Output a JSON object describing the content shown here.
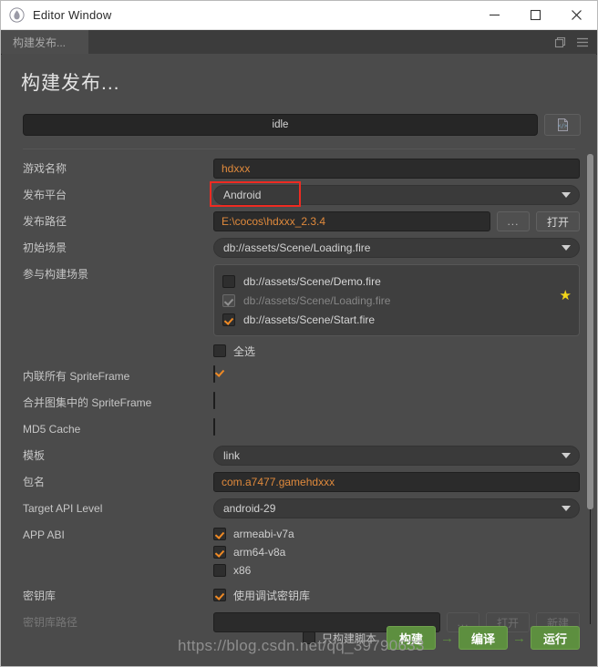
{
  "window": {
    "title": "Editor Window",
    "icon": "flame-icon",
    "minimize": "—",
    "maximize": "□",
    "close": "✕"
  },
  "tabbar": {
    "tab_label": "构建发布...",
    "popout_icon": "popout-window-icon",
    "menu_icon": "hamburger-menu-icon"
  },
  "page": {
    "title": "构建发布..."
  },
  "progress": {
    "status": "idle",
    "log_button_icon": "document-log-icon"
  },
  "fields": {
    "game_name": {
      "label": "游戏名称",
      "value": "hdxxx"
    },
    "platform": {
      "label": "发布平台",
      "value": "Android",
      "highlighted": true
    },
    "build_path": {
      "label": "发布路径",
      "value": "E:\\cocos\\hdxxx_2.3.4",
      "browse_label": "...",
      "open_label": "打开"
    },
    "start_scene": {
      "label": "初始场景",
      "value": "db://assets/Scene/Loading.fire"
    },
    "build_scenes": {
      "label": "参与构建场景",
      "items": [
        {
          "name": "db://assets/Scene/Demo.fire",
          "checked": false,
          "disabled": false,
          "starred": false
        },
        {
          "name": "db://assets/Scene/Loading.fire",
          "checked": true,
          "disabled": true,
          "starred": true
        },
        {
          "name": "db://assets/Scene/Start.fire",
          "checked": true,
          "disabled": false,
          "starred": false
        }
      ],
      "select_all_label": "全选",
      "select_all_checked": false
    },
    "inline_spriteframe": {
      "label": "内联所有 SpriteFrame",
      "checked": true
    },
    "merge_spriteframe": {
      "label": "合并图集中的 SpriteFrame",
      "checked": false
    },
    "md5_cache": {
      "label": "MD5 Cache",
      "checked": false
    },
    "template": {
      "label": "模板",
      "value": "link"
    },
    "package_name": {
      "label": "包名",
      "value": "com.a7477.gamehdxxx"
    },
    "target_api": {
      "label": "Target API Level",
      "value": "android-29"
    },
    "app_abi": {
      "label": "APP ABI",
      "items": [
        {
          "name": "armeabi-v7a",
          "checked": true
        },
        {
          "name": "arm64-v8a",
          "checked": true
        },
        {
          "name": "x86",
          "checked": false
        }
      ]
    },
    "keystore": {
      "label": "密钥库",
      "use_debug_label": "使用调试密钥库",
      "use_debug_checked": true
    },
    "keystore_path": {
      "label": "密钥库路径",
      "value": "",
      "disabled": true,
      "browse_label": "...",
      "open_label": "打开",
      "new_label": "新建"
    }
  },
  "bottom": {
    "only_script_label": "只构建脚本",
    "only_script_checked": false,
    "build_label": "构建",
    "compile_label": "编译",
    "run_label": "运行",
    "arrow": "→"
  },
  "watermark": "https://blog.csdn.net/qq_39790633",
  "colors": {
    "accent_orange": "#e08a3c",
    "checkbox_orange": "#f08a24",
    "green_button": "#5d8f3f",
    "highlight_red": "#ee2b22",
    "star_yellow": "#f2d61a",
    "panel_bg": "#4b4b4b",
    "input_bg": "#2b2b2b"
  }
}
